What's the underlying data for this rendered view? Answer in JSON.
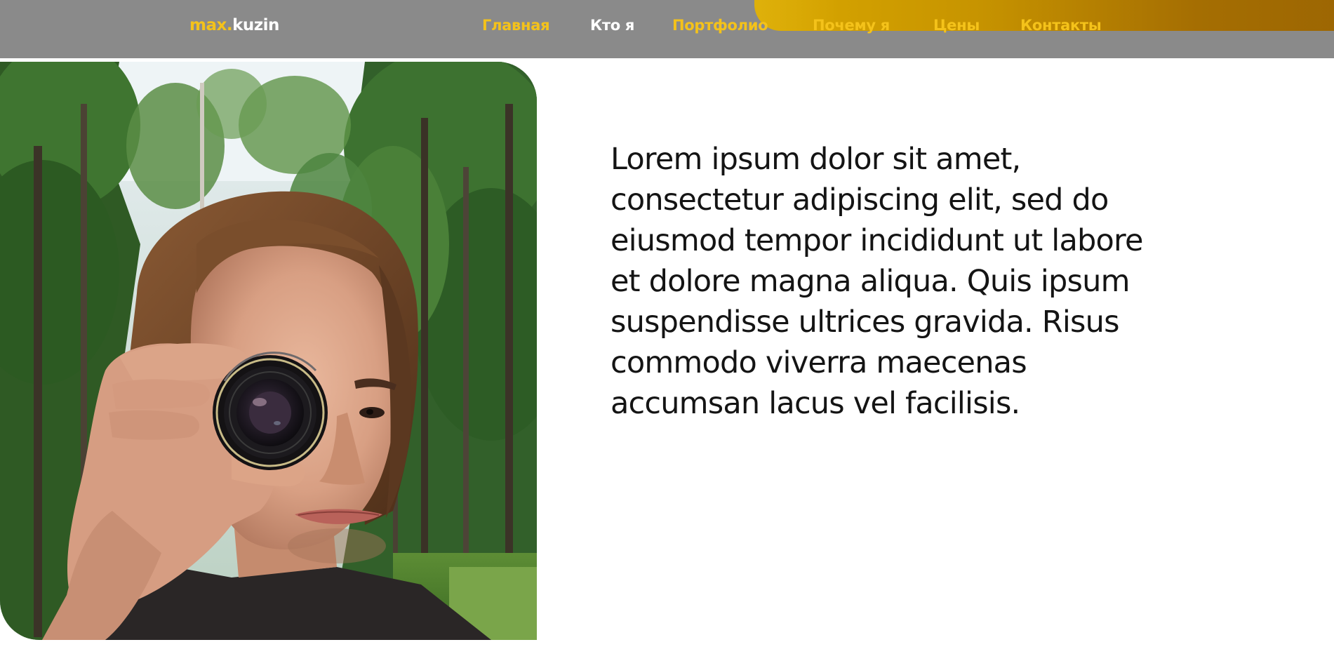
{
  "header": {
    "logo_part_a": "max.",
    "logo_part_b": "kuzin",
    "nav": [
      {
        "label": "Главная",
        "active": false
      },
      {
        "label": "Кто я",
        "active": true
      },
      {
        "label": "Портфолио",
        "active": false
      },
      {
        "label": "Почему я",
        "active": false
      },
      {
        "label": "Цены",
        "active": false
      },
      {
        "label": "Контакты",
        "active": false
      }
    ]
  },
  "colors": {
    "header_bg": "#8a8a8a",
    "accent": "#f4c21a",
    "active_nav": "#ffffff",
    "text": "#141414",
    "accent_bar": "#c79400"
  },
  "about": {
    "text": "Lorem ipsum dolor sit amet, consectetur adipiscing elit, sed do eiusmod tempor incididunt ut labore et dolore magna aliqua. Quis ipsum suspendisse ultrices gravida. Risus commodo viverra maecenas accumsan lacus vel facilisis."
  },
  "photo": {
    "icon": "portrait-photo"
  }
}
